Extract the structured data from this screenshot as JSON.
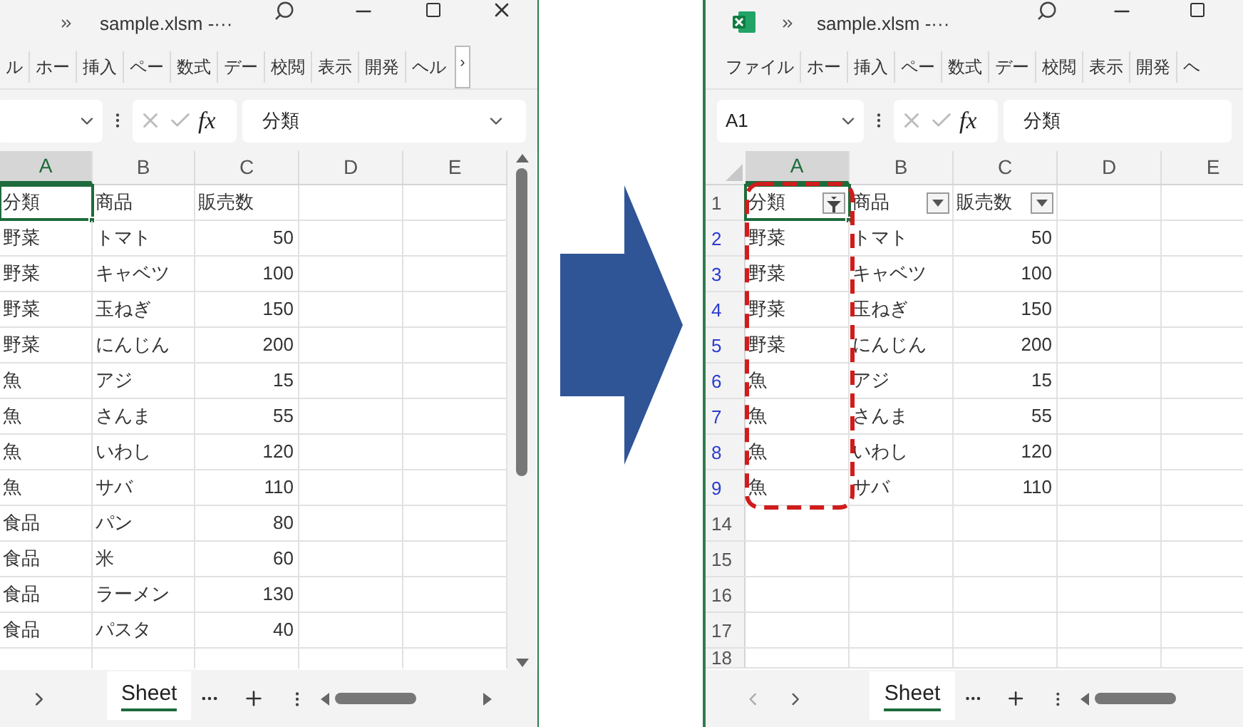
{
  "windows": [
    {
      "kind": "before",
      "title": "sample.xlsm -···",
      "ribbon_tabs": [
        "ル",
        "ホー",
        "挿入",
        "ペー",
        "数式",
        "デー",
        "校閲",
        "表示",
        "開発",
        "ヘル"
      ],
      "ribbon_overflow": "›",
      "formula": "分類",
      "function_label": "fx",
      "columns": [
        {
          "label": "A",
          "selected": true
        },
        {
          "label": "B",
          "selected": false
        },
        {
          "label": "C",
          "selected": false
        },
        {
          "label": "D",
          "selected": false
        },
        {
          "label": "E",
          "selected": false
        }
      ],
      "rows": [
        {
          "selected": true,
          "cells": [
            "分類",
            "商品",
            "販売数"
          ]
        },
        {
          "selected": false,
          "cells": [
            "野菜",
            "トマト",
            "50"
          ]
        },
        {
          "selected": false,
          "cells": [
            "野菜",
            "キャベツ",
            "100"
          ]
        },
        {
          "selected": false,
          "cells": [
            "野菜",
            "玉ねぎ",
            "150"
          ]
        },
        {
          "selected": false,
          "cells": [
            "野菜",
            "にんじん",
            "200"
          ]
        },
        {
          "selected": false,
          "cells": [
            "魚",
            "アジ",
            "15"
          ]
        },
        {
          "selected": false,
          "cells": [
            "魚",
            "さんま",
            "55"
          ]
        },
        {
          "selected": false,
          "cells": [
            "魚",
            "いわし",
            "120"
          ]
        },
        {
          "selected": false,
          "cells": [
            "魚",
            "サバ",
            "110"
          ]
        },
        {
          "selected": false,
          "cells": [
            "食品",
            "パン",
            "80"
          ]
        },
        {
          "selected": false,
          "cells": [
            "食品",
            "米",
            "60"
          ]
        },
        {
          "selected": false,
          "cells": [
            "食品",
            "ラーメン",
            "130"
          ]
        },
        {
          "selected": false,
          "cells": [
            "食品",
            "パスタ",
            "40"
          ]
        }
      ],
      "sheet_tab": "Sheet"
    },
    {
      "kind": "after",
      "title": "sample.xlsm -···",
      "ribbon_tabs": [
        "ファイル",
        "ホー",
        "挿入",
        "ペー",
        "数式",
        "デー",
        "校閲",
        "表示",
        "開発",
        "ヘ"
      ],
      "name_box": "A1",
      "formula": "分類",
      "function_label": "fx",
      "columns": [
        {
          "label": "A",
          "selected": true
        },
        {
          "label": "B",
          "selected": false
        },
        {
          "label": "C",
          "selected": false
        },
        {
          "label": "D",
          "selected": false
        },
        {
          "label": "E",
          "selected": false
        }
      ],
      "rows": [
        {
          "number": "1",
          "filtered": false,
          "selected": true,
          "cells": [
            "分類",
            "商品",
            "販売数"
          ],
          "filters": [
            {
              "kind": "active"
            },
            {
              "kind": "dropdown"
            },
            {
              "kind": "dropdown"
            }
          ]
        },
        {
          "number": "2",
          "filtered": true,
          "selected": false,
          "cells": [
            "野菜",
            "トマト",
            "50"
          ]
        },
        {
          "number": "3",
          "filtered": true,
          "selected": false,
          "cells": [
            "野菜",
            "キャベツ",
            "100"
          ]
        },
        {
          "number": "4",
          "filtered": true,
          "selected": false,
          "cells": [
            "野菜",
            "玉ねぎ",
            "150"
          ]
        },
        {
          "number": "5",
          "filtered": true,
          "selected": false,
          "cells": [
            "野菜",
            "にんじん",
            "200"
          ]
        },
        {
          "number": "6",
          "filtered": true,
          "selected": false,
          "cells": [
            "魚",
            "アジ",
            "15"
          ]
        },
        {
          "number": "7",
          "filtered": true,
          "selected": false,
          "cells": [
            "魚",
            "さんま",
            "55"
          ]
        },
        {
          "number": "8",
          "filtered": true,
          "selected": false,
          "cells": [
            "魚",
            "いわし",
            "120"
          ]
        },
        {
          "number": "9",
          "filtered": true,
          "selected": false,
          "cells": [
            "魚",
            "サバ",
            "110"
          ]
        },
        {
          "number": "14",
          "filtered": false,
          "selected": false
        },
        {
          "number": "15",
          "filtered": false,
          "selected": false
        },
        {
          "number": "16",
          "filtered": false,
          "selected": false
        },
        {
          "number": "17",
          "filtered": false,
          "selected": false
        },
        {
          "number": "18",
          "filtered": false,
          "selected": false
        }
      ],
      "sheet_tab": "Sheet"
    }
  ]
}
